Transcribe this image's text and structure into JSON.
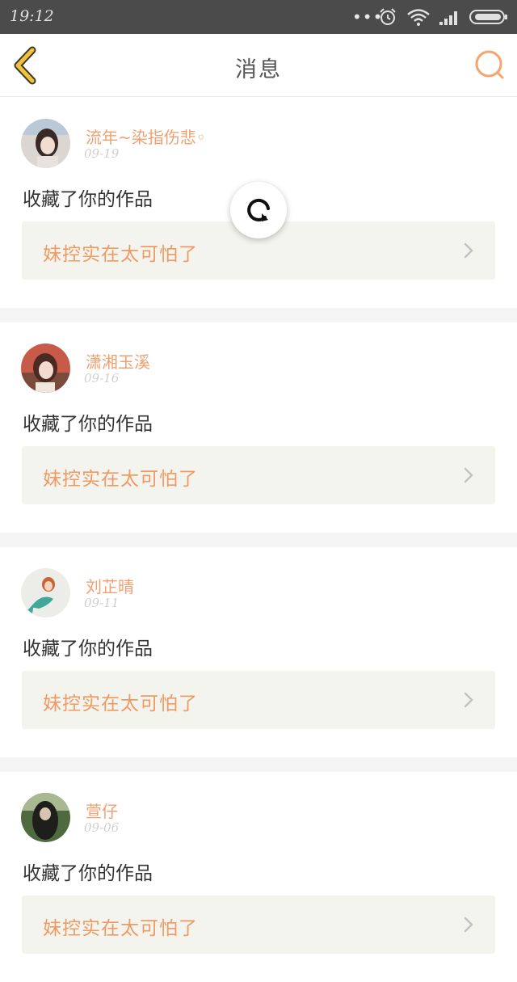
{
  "status_bar": {
    "time": "19:12",
    "more": "•••"
  },
  "header": {
    "title": "消息"
  },
  "messages": [
    {
      "username": "流年~染指伤悲◦",
      "date": "09-19",
      "action": "收藏了你的作品",
      "work_title": "妹控实在太可怕了"
    },
    {
      "username": "潇湘玉溪",
      "date": "09-16",
      "action": "收藏了你的作品",
      "work_title": "妹控实在太可怕了"
    },
    {
      "username": "刘芷晴",
      "date": "09-11",
      "action": "收藏了你的作品",
      "work_title": "妹控实在太可怕了"
    },
    {
      "username": "萱仔",
      "date": "09-06",
      "action": "收藏了你的作品",
      "work_title": "妹控实在太可怕了"
    }
  ],
  "colors": {
    "accent": "#f0a070",
    "status_bar": "#4b4b4b",
    "box_bg": "#f4f4ef"
  },
  "icons": [
    "back-icon",
    "search-icon",
    "refresh-icon",
    "chevron-right-icon",
    "alarm-icon",
    "wifi-icon",
    "signal-icon",
    "battery-icon"
  ]
}
